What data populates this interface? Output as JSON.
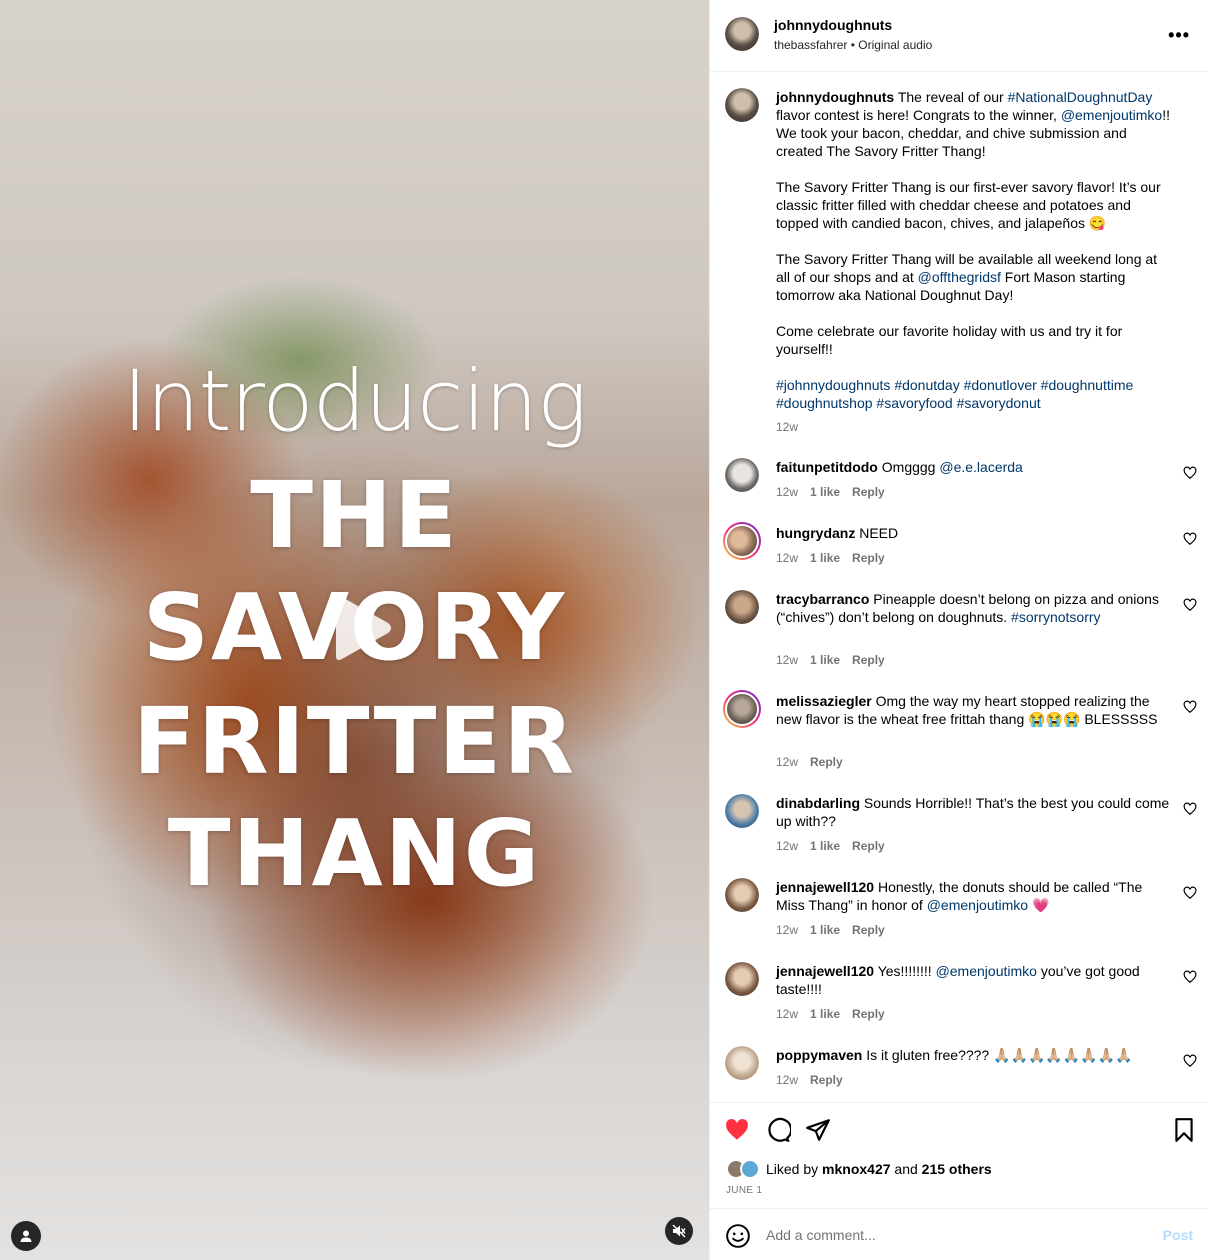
{
  "media": {
    "overlay_intro": "Introducing",
    "overlay_line1": "THE",
    "overlay_line2": "SAVORY",
    "overlay_line3": "FRITTER",
    "overlay_line4": "THANG",
    "play_icon": "play-icon",
    "user_icon": "person-icon",
    "mute_icon": "muted-speaker-icon"
  },
  "header": {
    "username": "johnnydoughnuts",
    "subtitle": "thebassfahrer • Original audio",
    "more_icon": "more-horizontal-icon",
    "more_label": "•••"
  },
  "caption": {
    "username": "johnnydoughnuts",
    "p1_a": "The reveal of our ",
    "p1_tag": "#NationalDoughnutDay",
    "p1_b": " flavor contest is here! Congrats to the winner, ",
    "p1_mention": "@emenjoutimko",
    "p1_c": "!! We took your bacon, cheddar, and chive submission and created The Savory Fritter Thang!",
    "p2": "The Savory Fritter Thang is our first-ever savory flavor! It’s our classic fritter filled with cheddar cheese and potatoes and topped with candied bacon, chives, and jalapeños 😋",
    "p3_a": "The Savory Fritter Thang will be available all weekend long at all of our shops and at ",
    "p3_mention": "@offthegridsf",
    "p3_b": " Fort Mason starting tomorrow aka National Doughnut Day!",
    "p4": "Come celebrate our favorite holiday with us and try it for yourself!!",
    "hashtags": "#johnnydoughnuts #donutday #donutlover #doughnuttime #doughnutshop #savoryfood #savorydonut",
    "time": "12w"
  },
  "comments": [
    {
      "username": "faitunpetitdodo",
      "text": "Omgggg ",
      "mention": "@e.e.lacerda",
      "time": "12w",
      "likes": "1 like",
      "reply": "Reply"
    },
    {
      "username": "hungrydanz",
      "text": "NEED",
      "time": "12w",
      "likes": "1 like",
      "reply": "Reply"
    },
    {
      "username": "tracybarranco",
      "text": "Pineapple doesn’t belong on pizza and onions (“chives”) don’t belong on doughnuts. ",
      "tag": "#sorrynotsorry",
      "time": "12w",
      "likes": "1 like",
      "reply": "Reply"
    },
    {
      "username": "melissaziegler",
      "text": "Omg the way my heart stopped realizing the new flavor is the wheat free frittah thang 😭😭😭 BLESSSSS",
      "time": "12w",
      "reply": "Reply"
    },
    {
      "username": "dinabdarling",
      "text": "Sounds Horrible!! That’s the best you could come up with??",
      "time": "12w",
      "likes": "1 like",
      "reply": "Reply"
    },
    {
      "username": "jennajewell120",
      "text": "Honestly, the donuts should be called “The Miss Thang” in honor of ",
      "mention": "@emenjoutimko",
      "tail": " 💗",
      "time": "12w",
      "likes": "1 like",
      "reply": "Reply"
    },
    {
      "username": "jennajewell120",
      "text": "Yes!!!!!!!! ",
      "mention": "@emenjoutimko",
      "tail": " you’ve got good taste!!!!",
      "time": "12w",
      "likes": "1 like",
      "reply": "Reply"
    },
    {
      "username": "poppymaven",
      "text": "Is it gluten free???? 🙏🏼🙏🏼🙏🏼🙏🏼🙏🏼🙏🏼🙏🏼🙏🏼",
      "time": "12w",
      "reply": "Reply"
    }
  ],
  "actions": {
    "like_icon": "heart-filled-icon",
    "comment_icon": "comment-icon",
    "share_icon": "send-icon",
    "save_icon": "bookmark-icon",
    "liked_prefix": "Liked by ",
    "liked_user": "mknox427",
    "liked_mid": " and ",
    "liked_count": "215 others",
    "date": "JUNE 1",
    "like_color": "#ff3040"
  },
  "composer": {
    "emoji_icon": "emoji-icon",
    "placeholder": "Add a comment...",
    "post_label": "Post"
  }
}
